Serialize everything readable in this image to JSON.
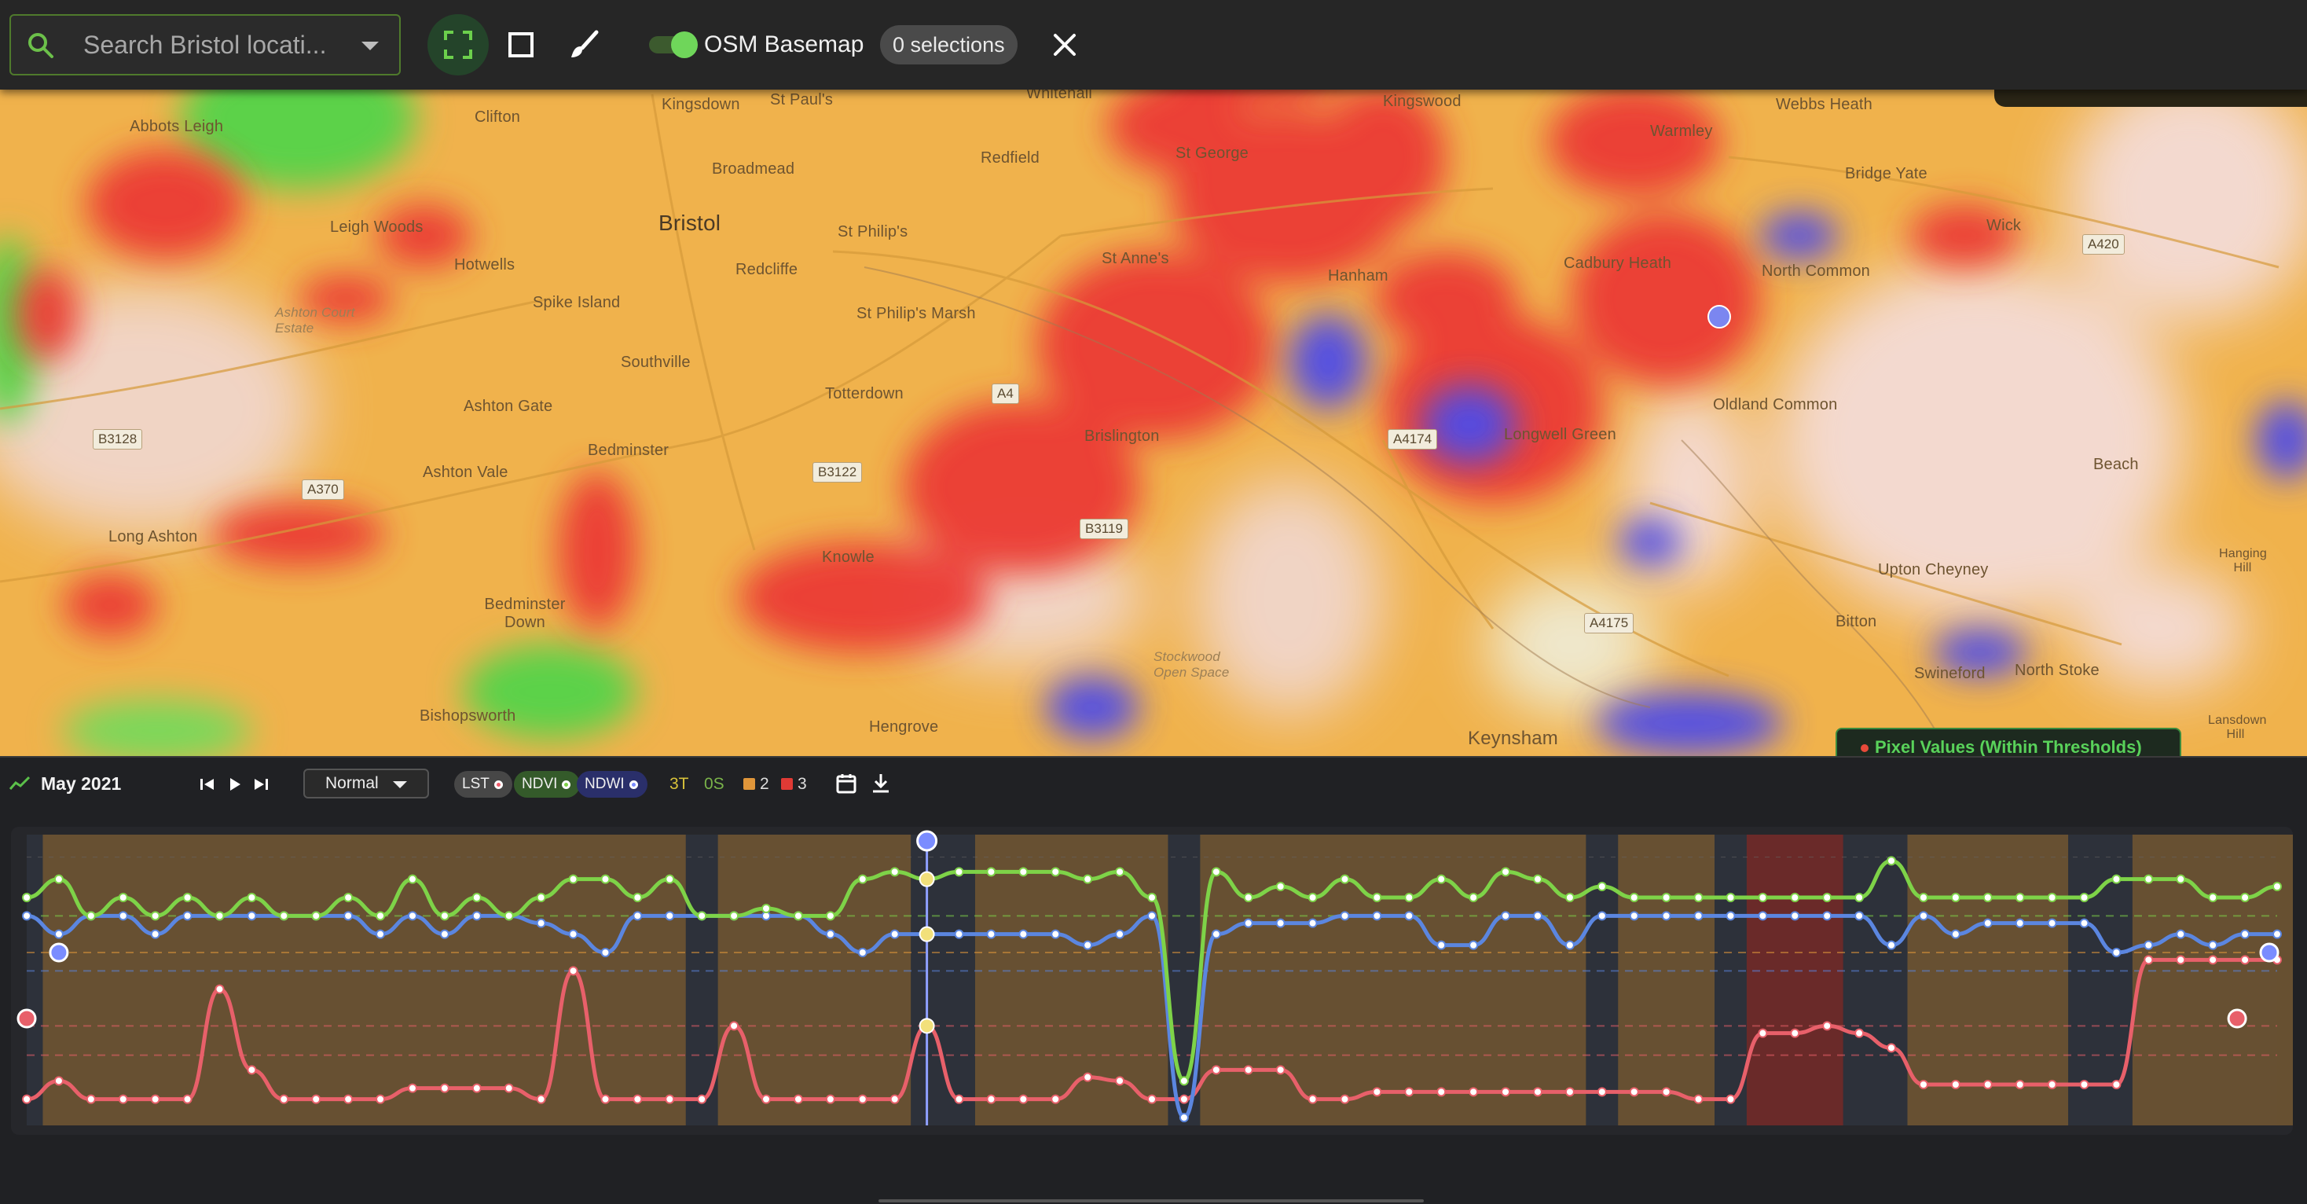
{
  "toolbar": {
    "search_placeholder": "Search Bristol locati...",
    "basemap_label": "OSM Basemap",
    "basemap_enabled": true,
    "selections_label": "0 selections"
  },
  "map": {
    "places": [
      {
        "name": "Abbots Leigh"
      },
      {
        "name": "Clifton"
      },
      {
        "name": "Kingsdown"
      },
      {
        "name": "St Paul's"
      },
      {
        "name": "Whitehall"
      },
      {
        "name": "Kingswood"
      },
      {
        "name": "Webbs Heath"
      },
      {
        "name": "Redfield"
      },
      {
        "name": "Broadmead"
      },
      {
        "name": "St George"
      },
      {
        "name": "Warmley"
      },
      {
        "name": "Bridge Yate"
      },
      {
        "name": "Leigh Woods"
      },
      {
        "name": "Bristol"
      },
      {
        "name": "St Philip's"
      },
      {
        "name": "Hotwells"
      },
      {
        "name": "Redcliffe"
      },
      {
        "name": "St Anne's"
      },
      {
        "name": "Hanham"
      },
      {
        "name": "Cadbury Heath"
      },
      {
        "name": "North Common"
      },
      {
        "name": "Wick"
      },
      {
        "name": "Spike Island"
      },
      {
        "name": "St Philip's Marsh"
      },
      {
        "name": "Southville"
      },
      {
        "name": "Ashton Gate"
      },
      {
        "name": "Totterdown"
      },
      {
        "name": "Oldland Common"
      },
      {
        "name": "Ashton Vale"
      },
      {
        "name": "Bedminster"
      },
      {
        "name": "Brislington"
      },
      {
        "name": "Longwell Green"
      },
      {
        "name": "Beach"
      },
      {
        "name": "Long Ashton"
      },
      {
        "name": "Knowle"
      },
      {
        "name": "Upton Cheyney"
      },
      {
        "name": "Bedminster Down"
      },
      {
        "name": "Bitton"
      },
      {
        "name": "Swineford"
      },
      {
        "name": "North Stoke"
      },
      {
        "name": "Bishopsworth"
      },
      {
        "name": "Hengrove"
      },
      {
        "name": "Keynsham"
      },
      {
        "name": "Lansdown Hill"
      },
      {
        "name": "Hanging Hill"
      },
      {
        "name": "Ashton Court Estate"
      },
      {
        "name": "Stockwood Open Space"
      }
    ],
    "roads": [
      "B3128",
      "A370",
      "B3122",
      "A4",
      "B3119",
      "A4174",
      "A4175",
      "A420"
    ],
    "tooltip_label": "Pixel Values (Within Thresholds)"
  },
  "panel": {
    "date_label": "May 2021",
    "mode": "Normal",
    "indices": [
      {
        "label": "LST",
        "color": "#f05d6c",
        "bg": "#474747"
      },
      {
        "label": "NDVI",
        "color": "#7ed348",
        "bg": "#345a2a"
      },
      {
        "label": "NDWI",
        "color": "#7a8cff",
        "bg": "#2a2f6a"
      }
    ],
    "legend": {
      "t_label": "3T",
      "t_color": "#d8c23a",
      "s_label": "0S",
      "s_color": "#7ab34a",
      "level2_label": "2",
      "level2_color": "#e0963a",
      "level3_label": "3",
      "level3_color": "#e03a35"
    }
  },
  "chart_data": {
    "type": "line",
    "n_points": 71,
    "selected_index": 28,
    "bands": [
      {
        "start": 1,
        "end": 20,
        "level": 2
      },
      {
        "start": 22,
        "end": 27,
        "level": 2
      },
      {
        "start": 30,
        "end": 35,
        "level": 2
      },
      {
        "start": 37,
        "end": 48,
        "level": 2
      },
      {
        "start": 50,
        "end": 52,
        "level": 2
      },
      {
        "start": 54,
        "end": 56,
        "level": 3
      },
      {
        "start": 59,
        "end": 63,
        "level": 2
      },
      {
        "start": 66,
        "end": 71,
        "level": 2
      }
    ],
    "series": [
      {
        "name": "NDVI",
        "color": "#7ed348",
        "values": [
          0.55,
          0.6,
          0.5,
          0.55,
          0.5,
          0.55,
          0.5,
          0.55,
          0.5,
          0.5,
          0.55,
          0.5,
          0.6,
          0.5,
          0.55,
          0.5,
          0.55,
          0.6,
          0.6,
          0.55,
          0.6,
          0.5,
          0.5,
          0.52,
          0.5,
          0.5,
          0.6,
          0.62,
          0.6,
          0.62,
          0.62,
          0.62,
          0.62,
          0.6,
          0.62,
          0.55,
          0.05,
          0.62,
          0.55,
          0.58,
          0.55,
          0.6,
          0.55,
          0.55,
          0.6,
          0.55,
          0.62,
          0.6,
          0.55,
          0.58,
          0.55,
          0.55,
          0.55,
          0.55,
          0.55,
          0.55,
          0.55,
          0.55,
          0.65,
          0.55,
          0.55,
          0.55,
          0.55,
          0.55,
          0.55,
          0.6,
          0.6,
          0.6,
          0.55,
          0.55,
          0.58
        ]
      },
      {
        "name": "NDWI",
        "color": "#5b86e0",
        "values": [
          0.5,
          0.45,
          0.5,
          0.5,
          0.45,
          0.5,
          0.5,
          0.5,
          0.5,
          0.5,
          0.5,
          0.45,
          0.5,
          0.45,
          0.5,
          0.5,
          0.48,
          0.45,
          0.4,
          0.5,
          0.5,
          0.5,
          0.5,
          0.5,
          0.5,
          0.45,
          0.4,
          0.45,
          0.45,
          0.45,
          0.45,
          0.45,
          0.45,
          0.42,
          0.45,
          0.5,
          -0.05,
          0.45,
          0.48,
          0.48,
          0.48,
          0.5,
          0.5,
          0.5,
          0.42,
          0.42,
          0.5,
          0.5,
          0.42,
          0.5,
          0.5,
          0.5,
          0.5,
          0.5,
          0.5,
          0.5,
          0.5,
          0.5,
          0.42,
          0.5,
          0.45,
          0.48,
          0.48,
          0.48,
          0.48,
          0.4,
          0.42,
          0.45,
          0.42,
          0.45,
          0.45
        ]
      },
      {
        "name": "LST",
        "color": "#e8606a",
        "values": [
          0.0,
          0.05,
          0.0,
          0.0,
          0.0,
          0.0,
          0.3,
          0.08,
          0.0,
          0.0,
          0.0,
          0.0,
          0.03,
          0.03,
          0.03,
          0.03,
          0.0,
          0.35,
          0.0,
          0.0,
          0.0,
          0.0,
          0.2,
          0.0,
          0.0,
          0.0,
          0.0,
          0.0,
          0.2,
          0.0,
          0.0,
          0.0,
          0.0,
          0.06,
          0.05,
          0.0,
          0.0,
          0.08,
          0.08,
          0.08,
          0.0,
          0.0,
          0.02,
          0.02,
          0.02,
          0.02,
          0.02,
          0.02,
          0.02,
          0.02,
          0.02,
          0.02,
          0.0,
          0.0,
          0.18,
          0.18,
          0.2,
          0.18,
          0.14,
          0.04,
          0.04,
          0.04,
          0.04,
          0.04,
          0.04,
          0.04,
          0.38,
          0.38,
          0.38,
          0.38,
          0.38
        ]
      }
    ],
    "gridlines": [
      "#7ed348",
      "#e0963a",
      "#5b86e0",
      "#e8606a"
    ]
  }
}
